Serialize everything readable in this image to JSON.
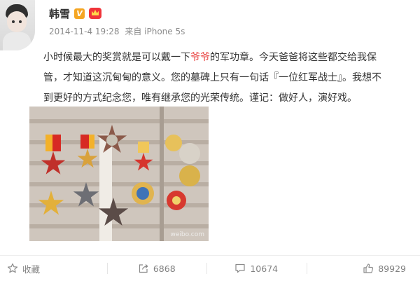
{
  "post": {
    "username": "韩雪",
    "verified_badge": "V",
    "meta_time": "2014-11-4 19:28",
    "meta_source": "来自 iPhone 5s",
    "content_lines": [
      [
        "小时候最大的奖赏就是可以戴一下",
        "爷爷",
        "的军功章。今天爸爸将这些都交给我保"
      ],
      [
        "管，才知道这沉甸甸的意义。您的墓碑上只有一句话『一位红军战士』。我想不"
      ],
      [
        "到更好的方式纪念您，唯有继承您的光荣传统。谨记：做好人，演好戏。"
      ]
    ],
    "highlight_color": "#e8423f",
    "photo_watermark": "weibo.com"
  },
  "actions": {
    "favorite_label": "收藏",
    "repost_count": "6868",
    "comment_count": "10674",
    "like_count": "89929"
  },
  "icons": {
    "favorite": "star-icon",
    "repost": "share-icon",
    "comment": "comment-icon",
    "like": "thumbs-up-icon"
  }
}
